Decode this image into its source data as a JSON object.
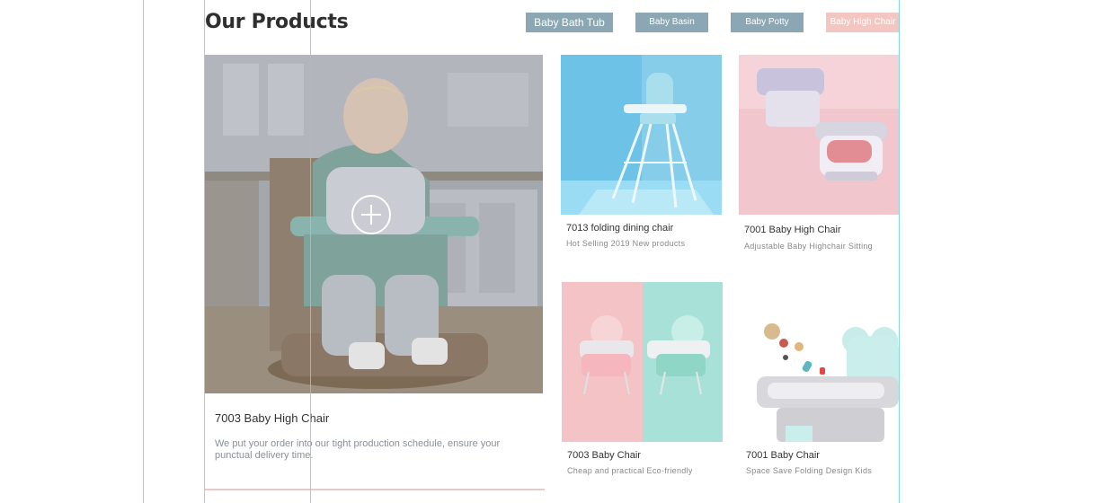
{
  "section": {
    "title": "Our Products"
  },
  "tabs": [
    {
      "label": "Baby Bath Tub",
      "color": "#8aa7b3"
    },
    {
      "label": "Baby Basin",
      "color": "#8aa7b3"
    },
    {
      "label": "Baby Potty",
      "color": "#8aa7b3"
    },
    {
      "label": "Baby High Chair",
      "color": "#f3c6c1"
    }
  ],
  "featured": {
    "title": "7003 Baby High Chair",
    "description": "We put your order into our tight production schedule, ensure your punctual delivery time.",
    "icon": "plus-circle-icon"
  },
  "products": [
    {
      "title": "7013 folding dining chair",
      "subtitle": "Hot Selling 2019 New products"
    },
    {
      "title": "7001 Baby High Chair",
      "subtitle": "Adjustable Baby Highchair Sitting"
    },
    {
      "title": "7003 Baby Chair",
      "subtitle": "Cheap and practical Eco-friendly"
    },
    {
      "title": "7001 Baby Chair",
      "subtitle": "Space Save Folding Design Kids"
    }
  ],
  "colors": {
    "guide": "#6fd6e3",
    "tab": "#8aa7b3",
    "tab_active": "#f3c6c1",
    "divider": "#e8c7cb"
  }
}
